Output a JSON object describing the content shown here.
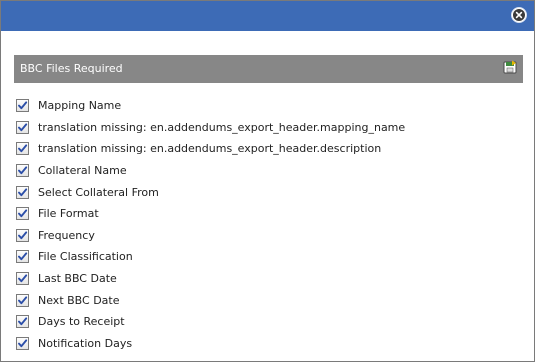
{
  "colors": {
    "titlebar": "#3d6bb6",
    "section_header": "#878787",
    "checkmark": "#2b4ea8"
  },
  "icons": {
    "close": "close-icon",
    "export": "export-icon"
  },
  "section": {
    "title": "BBC Files Required"
  },
  "fields": [
    {
      "label": "Mapping Name",
      "checked": true
    },
    {
      "label": "translation missing: en.addendums_export_header.mapping_name",
      "checked": true
    },
    {
      "label": "translation missing: en.addendums_export_header.description",
      "checked": true
    },
    {
      "label": "Collateral Name",
      "checked": true
    },
    {
      "label": "Select Collateral From",
      "checked": true
    },
    {
      "label": "File Format",
      "checked": true
    },
    {
      "label": "Frequency",
      "checked": true
    },
    {
      "label": "File Classification",
      "checked": true
    },
    {
      "label": "Last BBC Date",
      "checked": true
    },
    {
      "label": "Next BBC Date",
      "checked": true
    },
    {
      "label": "Days to Receipt",
      "checked": true
    },
    {
      "label": "Notification Days",
      "checked": true
    }
  ]
}
